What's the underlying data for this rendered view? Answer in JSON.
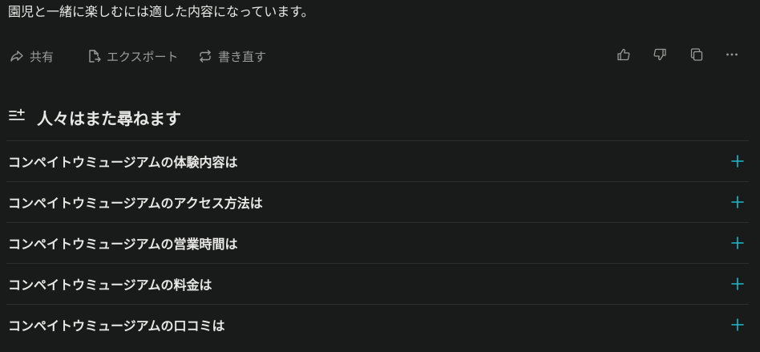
{
  "answer": {
    "text": "園児と一緒に楽しむには適した内容になっています。"
  },
  "actions": {
    "share_label": "共有",
    "export_label": "エクスポート",
    "rewrite_label": "書き直す"
  },
  "icons": {
    "share": "share-icon",
    "export": "export-icon",
    "rewrite": "rewrite-icon",
    "thumbs_up": "thumbs-up-icon",
    "thumbs_down": "thumbs-down-icon",
    "copy": "copy-icon",
    "more": "more-icon",
    "related": "related-list-icon",
    "expand": "plus-icon"
  },
  "related": {
    "title": "人々はまた尋ねます",
    "items": [
      {
        "label": "コンペイトウミュージアムの体験内容は"
      },
      {
        "label": "コンペイトウミュージアムのアクセス方法は"
      },
      {
        "label": "コンペイトウミュージアムの営業時間は"
      },
      {
        "label": "コンペイトウミュージアムの料金は"
      },
      {
        "label": "コンペイトウミュージアムの口コミは"
      }
    ]
  },
  "colors": {
    "background": "#191a1a",
    "text": "#e8e8e6",
    "muted": "#9a9b99",
    "accent": "#20b8cd",
    "divider": "#2e3030"
  }
}
